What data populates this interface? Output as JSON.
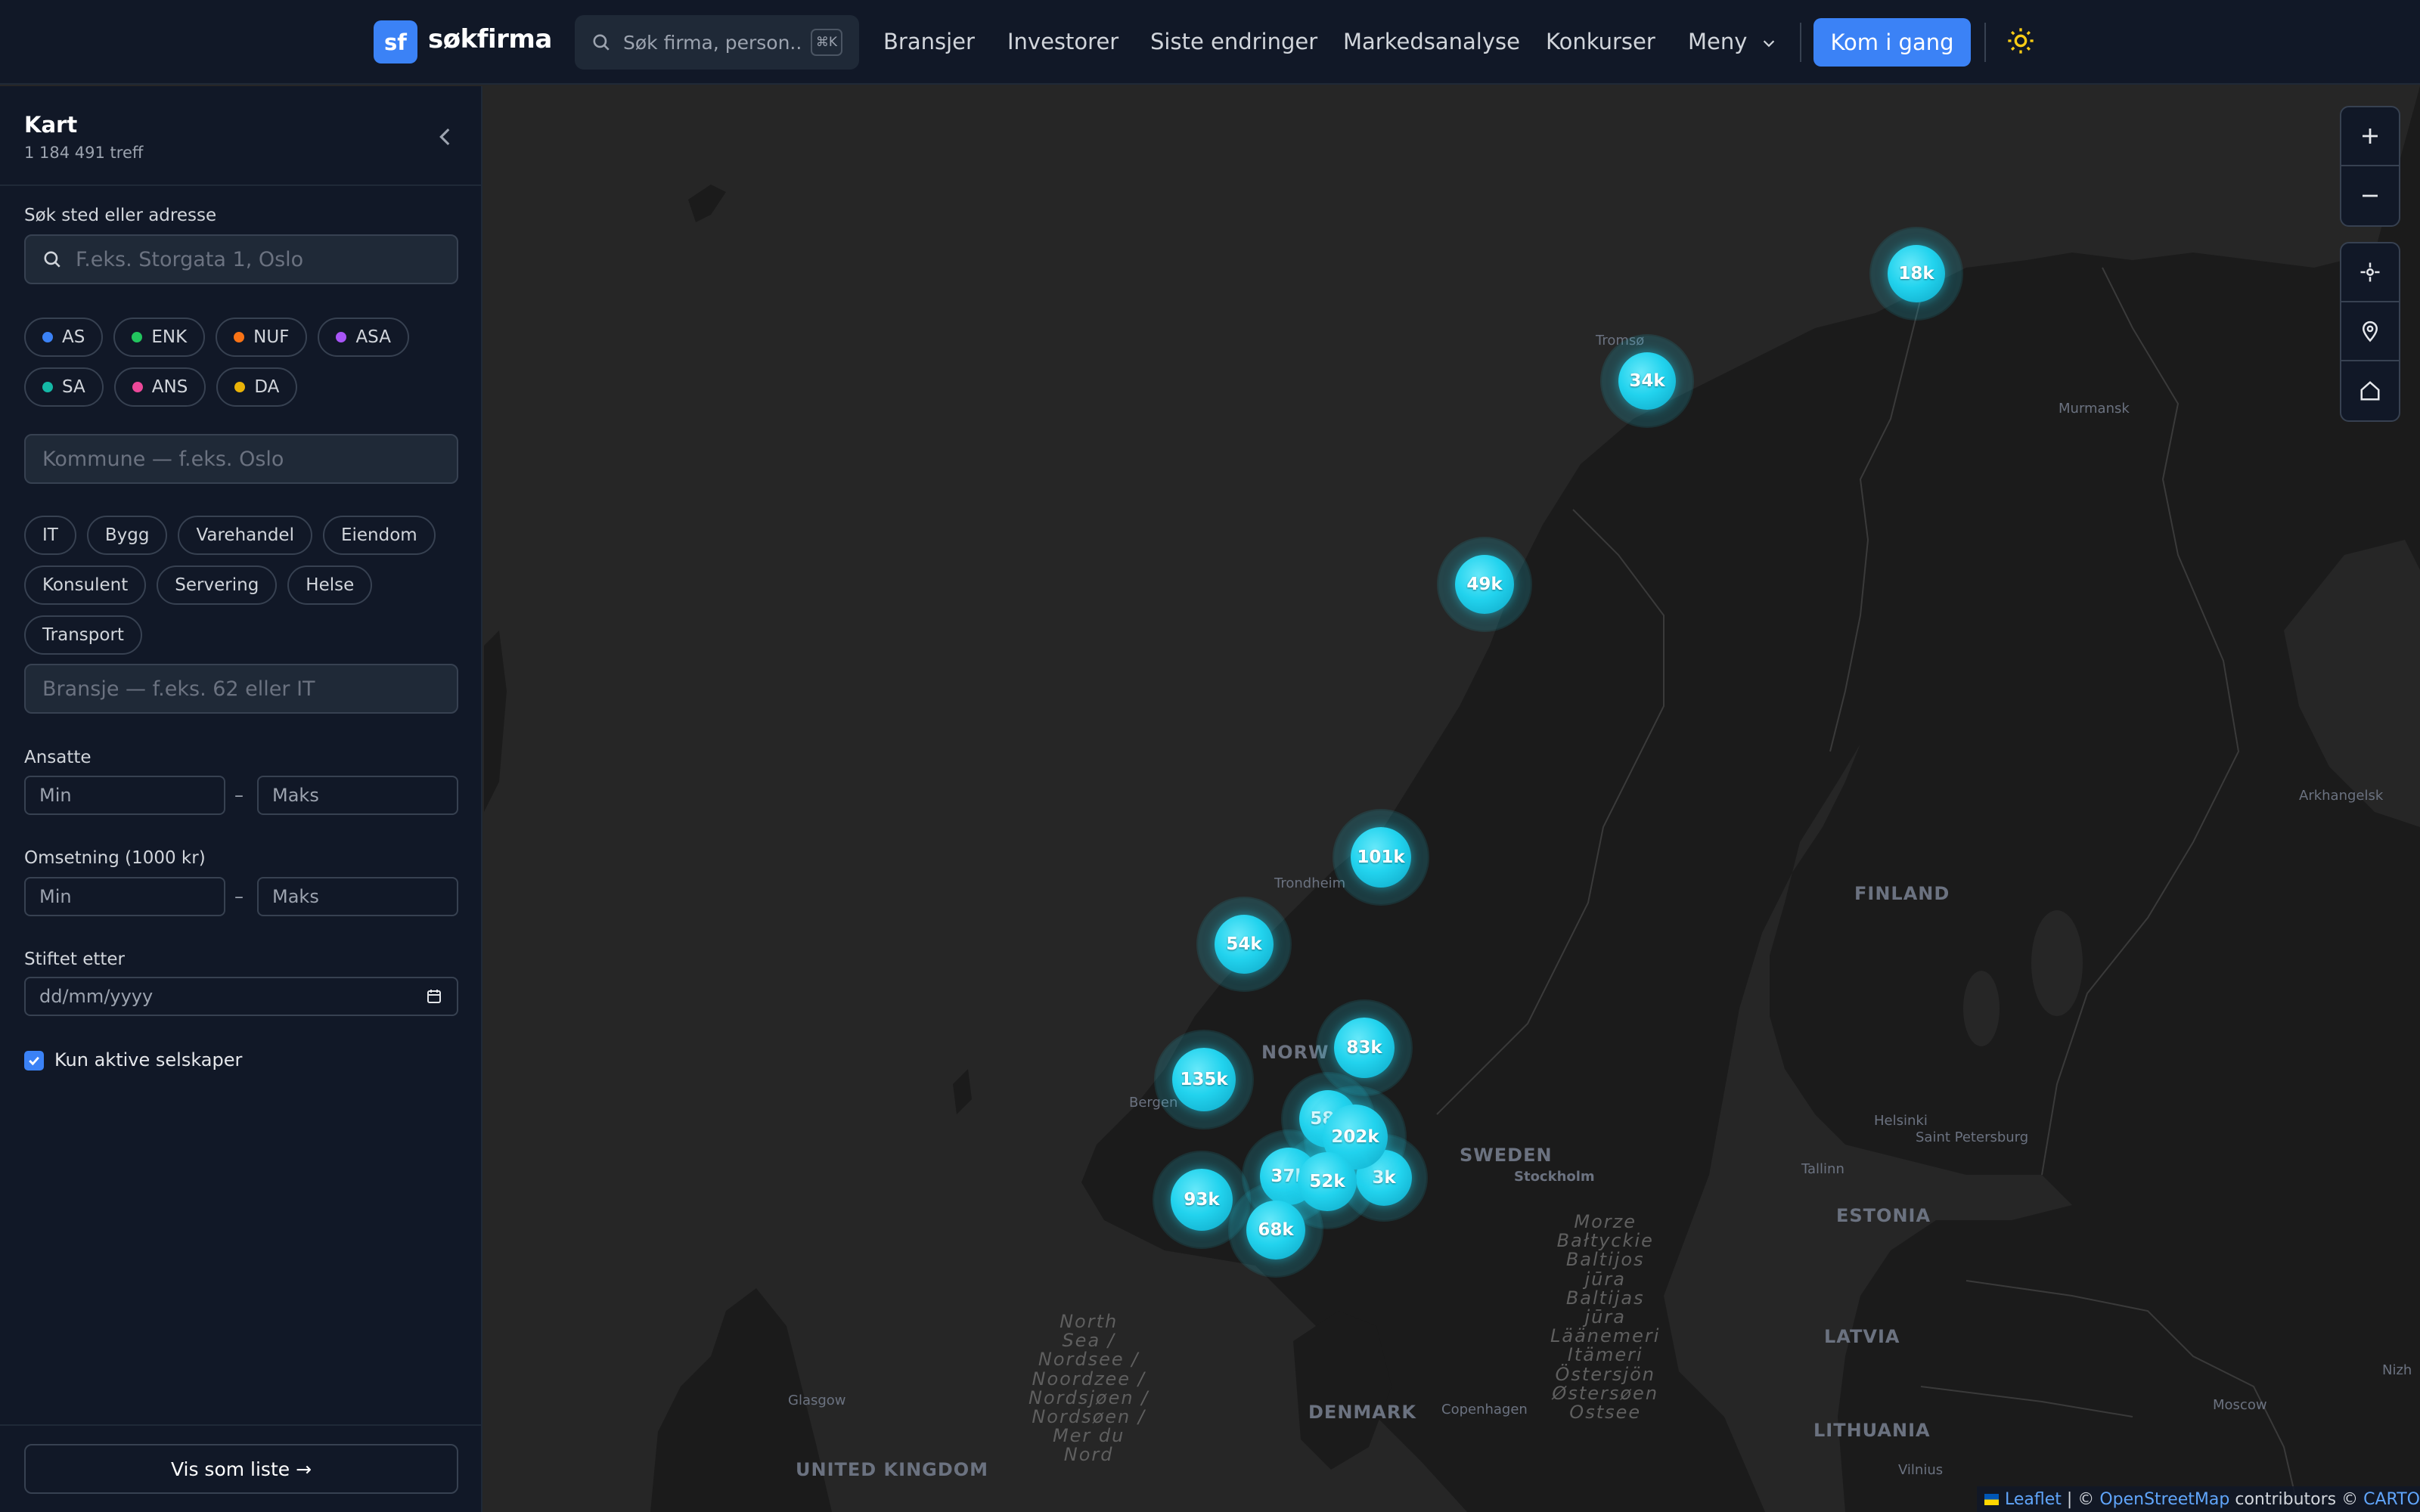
{
  "header": {
    "logo_short": "sf",
    "logo_text": "søkfirma",
    "search_placeholder": "Søk firma, person...",
    "search_shortcut": "⌘K",
    "nav": [
      "Bransjer",
      "Investorer",
      "Siste endringer",
      "Markedsanalyse",
      "Konkurser"
    ],
    "menu_label": "Meny",
    "cta_label": "Kom i gang"
  },
  "sidebar": {
    "title": "Kart",
    "count": "1 184 491 treff",
    "location_label": "Søk sted eller adresse",
    "location_placeholder": "F.eks. Storgata 1, Oslo",
    "org_types": [
      {
        "label": "AS",
        "color": "#3b82f6"
      },
      {
        "label": "ENK",
        "color": "#22c55e"
      },
      {
        "label": "NUF",
        "color": "#f97316"
      },
      {
        "label": "ASA",
        "color": "#a855f7"
      },
      {
        "label": "SA",
        "color": "#14b8a6"
      },
      {
        "label": "ANS",
        "color": "#ec4899"
      },
      {
        "label": "DA",
        "color": "#eab308"
      }
    ],
    "kommune_placeholder": "Kommune — f.eks. Oslo",
    "industries": [
      "IT",
      "Bygg",
      "Varehandel",
      "Eiendom",
      "Konsulent",
      "Servering",
      "Helse",
      "Transport"
    ],
    "industry_placeholder": "Bransje — f.eks. 62 eller IT",
    "employees_label": "Ansatte",
    "revenue_label": "Omsetning (1000 kr)",
    "min_placeholder": "Min",
    "max_placeholder": "Maks",
    "range_dash": "–",
    "founded_label": "Stiftet etter",
    "date_placeholder": "dd/mm/yyyy",
    "active_only_label": "Kun aktive selskaper",
    "active_only_checked": true,
    "list_button": "Vis som liste →"
  },
  "map": {
    "clusters": [
      {
        "label": "18k"
      },
      {
        "label": "34k"
      },
      {
        "label": "49k"
      },
      {
        "label": "101k"
      },
      {
        "label": "54k"
      },
      {
        "label": "83k"
      },
      {
        "label": "135k"
      },
      {
        "label": "58k"
      },
      {
        "label": "202k"
      },
      {
        "label": "3k"
      },
      {
        "label": "37k"
      },
      {
        "label": "52k"
      },
      {
        "label": "93k"
      },
      {
        "label": "68k"
      }
    ],
    "places": [
      "Tromsø",
      "Murmansk",
      "Trondheim",
      "Bergen",
      "Helsinki",
      "Saint Petersburg",
      "Tallinn",
      "Stockholm",
      "Copenhagen",
      "Glasgow",
      "Arkhangelsk",
      "Moscow",
      "Vilnius",
      "Nizh"
    ],
    "countries": [
      "FINLAND",
      "SWEDEN",
      "NORW",
      "ESTONIA",
      "LATVIA",
      "LITHUANIA",
      "DENMARK",
      "UNITED KINGDOM"
    ],
    "seas": {
      "north_sea": "North\nSea /\nNordsee /\nNoordzee /\nNordsjøen /\nNordsøen /\nMer du\nNord",
      "baltic": "Morze\nBałtyckie\nBaltijos\njūra\nBaltijas\njūra\nLäänemeri\nItämeri\nÖstersjön\nØstersøen\nOstsee"
    },
    "attribution": {
      "leaflet": "Leaflet",
      "sep1": "| ©",
      "osm": "OpenStreetMap",
      "contrib": "contributors ©",
      "carto": "CARTO"
    }
  },
  "colors": {
    "accent": "#3b82f6",
    "cluster": "#22d3ee",
    "background": "#111827"
  }
}
